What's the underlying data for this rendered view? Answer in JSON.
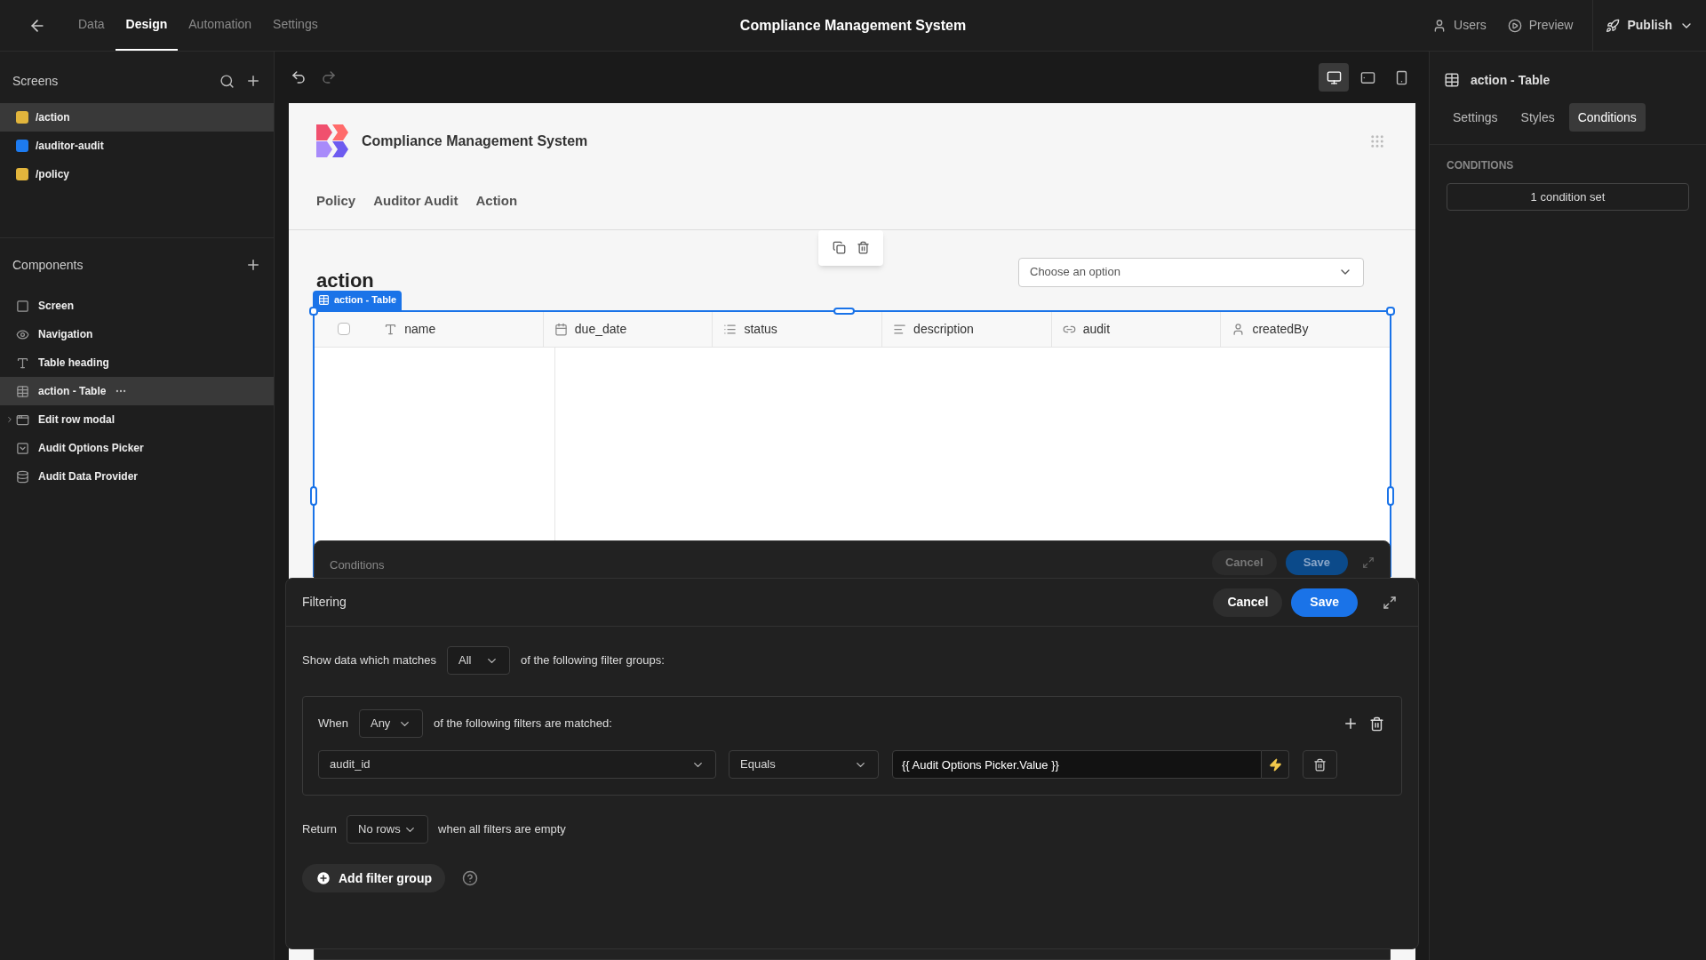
{
  "top_bar": {
    "tabs": [
      {
        "label": "Data",
        "selected": false
      },
      {
        "label": "Design",
        "selected": true
      },
      {
        "label": "Automation",
        "selected": false
      },
      {
        "label": "Settings",
        "selected": false
      }
    ],
    "title": "Compliance Management System",
    "users": "Users",
    "preview": "Preview",
    "publish": "Publish"
  },
  "sidebar": {
    "screens_title": "Screens",
    "screens": [
      {
        "label": "/action",
        "color": "#e2b53c",
        "selected": true
      },
      {
        "label": "/auditor-audit",
        "color": "#1d7bf0",
        "selected": false
      },
      {
        "label": "/policy",
        "color": "#e2b53c",
        "selected": false
      }
    ],
    "components_title": "Components",
    "components": [
      {
        "label": "Screen",
        "kind": "screen",
        "selected": false,
        "expandable": false
      },
      {
        "label": "Navigation",
        "kind": "navigation",
        "selected": false,
        "expandable": false
      },
      {
        "label": "Table heading",
        "kind": "heading",
        "selected": false,
        "expandable": false
      },
      {
        "label": "action - Table",
        "kind": "table",
        "selected": true,
        "expandable": false
      },
      {
        "label": "Edit row modal",
        "kind": "modal",
        "selected": false,
        "expandable": true
      },
      {
        "label": "Audit Options Picker",
        "kind": "picker",
        "selected": false,
        "expandable": false
      },
      {
        "label": "Audit Data Provider",
        "kind": "provider",
        "selected": false,
        "expandable": false
      }
    ]
  },
  "toolbar": {
    "devices": [
      {
        "kind": "desktop",
        "selected": true
      },
      {
        "kind": "tablet",
        "selected": false
      },
      {
        "kind": "mobile",
        "selected": false
      }
    ]
  },
  "canvas": {
    "app_title": "Compliance Management System",
    "nav": [
      "Policy",
      "Auditor Audit",
      "Action"
    ],
    "heading": "action",
    "picker_placeholder": "Choose an option",
    "table_tag": "action - Table",
    "table": {
      "select_all_checked": false,
      "columns": [
        {
          "label": "name",
          "kind": "text"
        },
        {
          "label": "due_date",
          "kind": "date"
        },
        {
          "label": "status",
          "kind": "options"
        },
        {
          "label": "description",
          "kind": "longform"
        },
        {
          "label": "audit",
          "kind": "link"
        },
        {
          "label": "createdBy",
          "kind": "user"
        }
      ]
    }
  },
  "conditions_modal": {
    "title": "Conditions",
    "cancel": "Cancel",
    "save": "Save"
  },
  "filtering_modal": {
    "title": "Filtering",
    "cancel": "Cancel",
    "save": "Save",
    "match_prefix": "Show data which matches",
    "match_value": "All",
    "match_suffix": "of the following filter groups:",
    "groups": [
      {
        "when": "When",
        "match": "Any",
        "suffix": "of the following filters are matched:",
        "filters": [
          {
            "field": "audit_id",
            "operator": "Equals",
            "value": "{{ Audit Options Picker.Value }}"
          }
        ]
      }
    ],
    "return_label": "Return",
    "return_value": "No rows",
    "return_suffix": "when all filters are empty",
    "add_group": "Add filter group"
  },
  "properties": {
    "title": "action - Table",
    "tabs": [
      {
        "label": "Settings",
        "selected": false
      },
      {
        "label": "Styles",
        "selected": false
      },
      {
        "label": "Conditions",
        "selected": true
      }
    ],
    "section": "CONDITIONS",
    "conditions_button": "1 condition set"
  }
}
